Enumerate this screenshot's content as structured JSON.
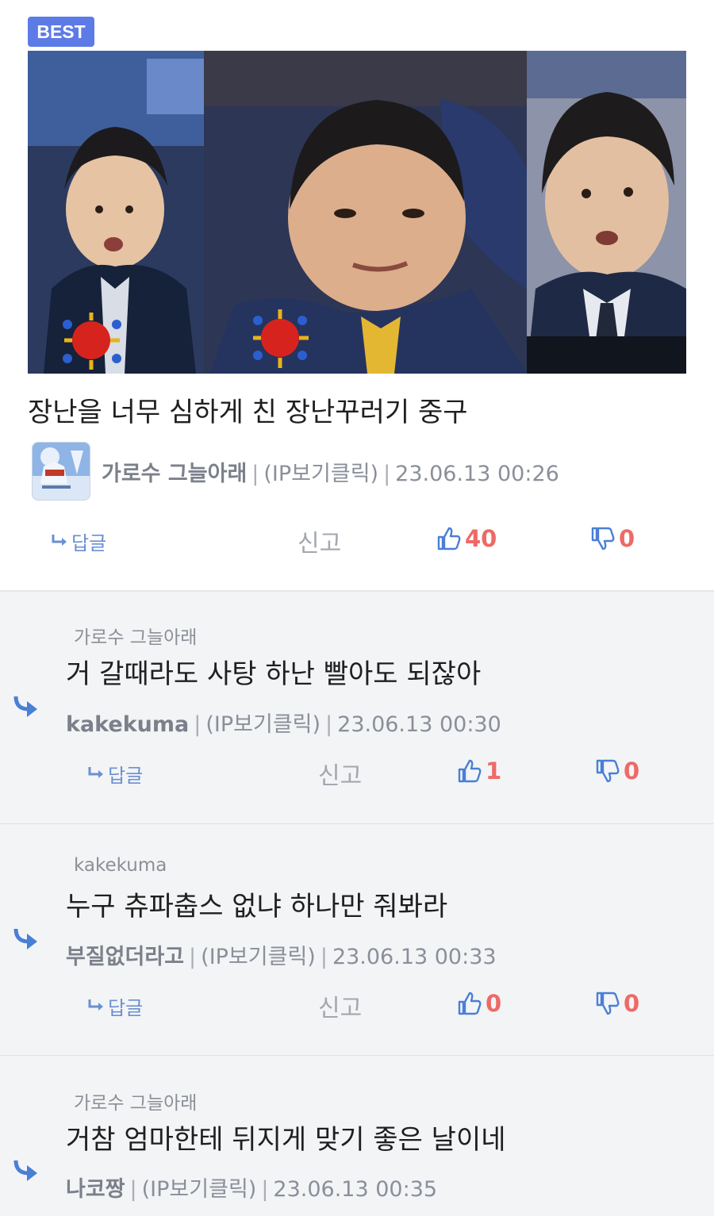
{
  "best_post": {
    "badge": "BEST",
    "title": "장난을 너무 심하게 친 장난꾸러기 중구",
    "author": "가로수 그늘아래",
    "ip": "(IP보기클릭)",
    "datetime": "23.06.13 00:26",
    "actions": {
      "reply_label": "답글",
      "report_label": "신고",
      "likes": "40",
      "dislikes": "0"
    }
  },
  "comments": [
    {
      "parent": "가로수 그늘아래",
      "body": "거 갈때라도 사탕 하난 빨아도 되잖아",
      "author": "kakekuma",
      "ip": "(IP보기클릭)",
      "datetime": "23.06.13 00:30",
      "reply_label": "답글",
      "report_label": "신고",
      "likes": "1",
      "dislikes": "0"
    },
    {
      "parent": "kakekuma",
      "body": "누구 츄파춥스 없냐 하나만 줘봐라",
      "author": "부질없더라고",
      "ip": "(IP보기클릭)",
      "datetime": "23.06.13 00:33",
      "reply_label": "답글",
      "report_label": "신고",
      "likes": "0",
      "dislikes": "0"
    },
    {
      "parent": "가로수 그늘아래",
      "body": "거참 엄마한테 뒤지게 맞기 좋은 날이네",
      "author": "나코짱",
      "ip": "(IP보기클릭)",
      "datetime": "23.06.13 00:35"
    }
  ],
  "colors": {
    "accent": "#5c7be6",
    "like": "#ee6a67",
    "icon_blue": "#4a7fd6",
    "comment_bg": "#f3f4f6"
  },
  "icons": {
    "reply": "reply-arrow-icon",
    "like": "thumbs-up-icon",
    "dislike": "thumbs-down-icon"
  }
}
